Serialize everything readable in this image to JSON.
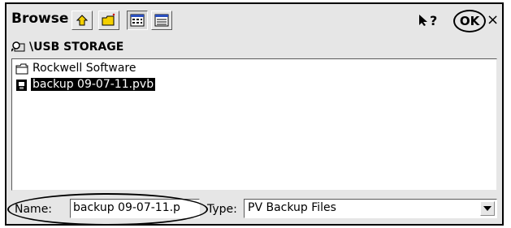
{
  "window": {
    "title": "Browse"
  },
  "toolbar": {
    "help_label": "?",
    "ok_label": "OK",
    "close_label": "×"
  },
  "path": {
    "label": "\\USB STORAGE"
  },
  "files": [
    {
      "name": "Rockwell Software",
      "icon": "folder-icon",
      "selected": false
    },
    {
      "name": "backup 09-07-11.pvb",
      "icon": "file-icon",
      "selected": true
    }
  ],
  "form": {
    "name_label": "Name:",
    "name_value": "backup 09-07-11.p",
    "type_label": "Type:",
    "type_value": "PV Backup Files"
  },
  "colors": {
    "dialog_bg": "#e6e6e6",
    "selection_bg": "#000000"
  }
}
